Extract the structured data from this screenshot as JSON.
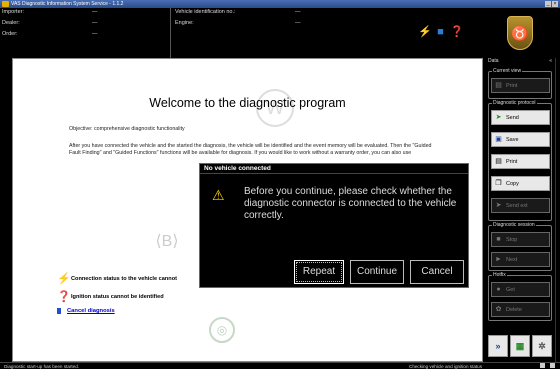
{
  "window": {
    "title": "VAS Diagnostic Information System Service - 1.1.2"
  },
  "header": {
    "importer_label": "Importer:",
    "importer_value": "—",
    "dealer_label": "Dealer:",
    "dealer_value": "—",
    "order_label": "Order:",
    "order_value": "—",
    "vin_label": "Vehicle identification no.:",
    "vin_value": "—",
    "engine_label": "Engine:",
    "engine_value": "—"
  },
  "main": {
    "title": "Welcome to the diagnostic program",
    "objective": "Objective: comprehensive diagnostic functionality",
    "para": "After you have connected the vehicle and the started the diagnosis, the vehicle will be identified and the event memory will be evaluated. Then the \"Guided Fault Finding\" and \"Guided Functions\" functions will be available for diagnosis. If you would like to work without a warranty order, you can also use",
    "status1": "Connection status to the vehicle cannot",
    "status2": "Ignition status cannot be identified",
    "cancel": "Cancel diagnosis"
  },
  "dialog": {
    "title": "No vehicle connected",
    "message": "Before you continue, please check whether the diagnostic connector is connected to the vehicle correctly.",
    "btn_repeat": "Repeat",
    "btn_continue": "Continue",
    "btn_cancel": "Cancel"
  },
  "sidebar": {
    "data_label": "Data",
    "groups": {
      "current_view": "Current view",
      "diagnostic_protocol": "Diagnostic protocol",
      "diagnostic_session": "Diagnostic session",
      "hotfix": "Hotfix"
    },
    "buttons": {
      "print1": "Print",
      "send": "Send",
      "save": "Save",
      "print2": "Print",
      "copy": "Copy",
      "send_ext": "Send ext",
      "stop": "Stop",
      "next": "Next",
      "get": "Get",
      "delete": "Delete"
    }
  },
  "statusbar": {
    "left": "Diagnostic start-up has been started.",
    "right": "Checking vehicle and ignition status"
  }
}
